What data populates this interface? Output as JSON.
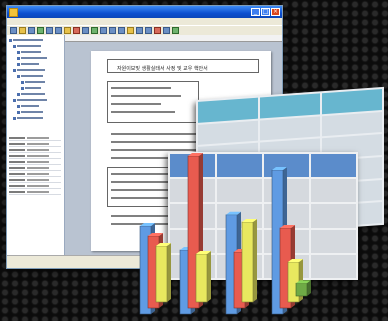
{
  "window": {
    "title": "",
    "controls": [
      "_",
      "□",
      "×"
    ],
    "menu": [
      "",
      "",
      "",
      "",
      "",
      "",
      "",
      ""
    ]
  },
  "document": {
    "heading": "자원이보및 생활실태서 사정 및 교우 핵안서"
  },
  "chart_data": {
    "type": "bar",
    "title": "",
    "xlabel": "",
    "ylabel": "",
    "categories": [
      "",
      "",
      "",
      ""
    ],
    "series": [
      {
        "color": "#5f9be3",
        "values": [
          55,
          40,
          62,
          90
        ]
      },
      {
        "color": "#e85b4f",
        "values": [
          45,
          95,
          35,
          50
        ]
      },
      {
        "color": "#e8e85f",
        "values": [
          35,
          30,
          50,
          25
        ]
      },
      {
        "color": "#6faa46",
        "values": [
          0,
          0,
          0,
          8
        ]
      }
    ],
    "ylim": [
      0,
      100
    ],
    "grid": false
  },
  "colors": {
    "background": "#0c0c0c",
    "titlebar": "#0b4fd1",
    "table_header_front": "#5b8ccb",
    "table_header_back": "#67b6cf"
  }
}
